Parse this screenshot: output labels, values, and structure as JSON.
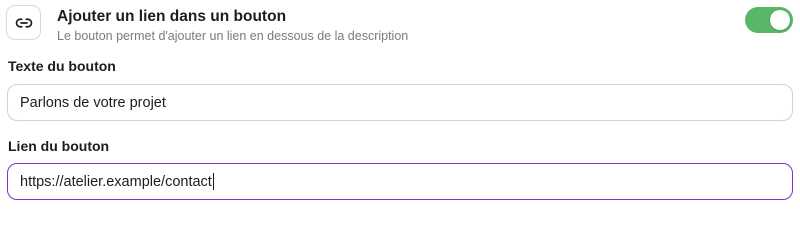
{
  "option": {
    "icon": "link-icon",
    "title": "Ajouter un lien dans un bouton",
    "description": "Le bouton permet d'ajouter un lien en dessous de la description",
    "enabled": true,
    "toggle_color": "#58b868"
  },
  "button_text_field": {
    "label": "Texte du bouton",
    "value": "Parlons de votre projet"
  },
  "button_link_field": {
    "label": "Lien du bouton",
    "value": "https://atelier.example/contact",
    "focused": true,
    "focus_color": "#7c35c9"
  }
}
